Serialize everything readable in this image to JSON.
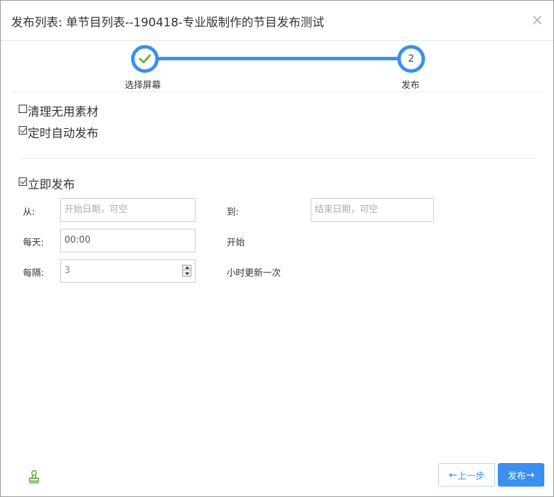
{
  "dialog": {
    "title": "发布列表: 单节目列表--190418-专业版制作的节目发布测试",
    "close_symbol": "×"
  },
  "steps": [
    {
      "label": "选择屏幕",
      "status": "done",
      "icon": "check-icon"
    },
    {
      "label": "发布",
      "number": "2",
      "status": "active"
    }
  ],
  "options": {
    "clean_unused": {
      "label": "清理无用素材",
      "checked": false
    },
    "scheduled_publish": {
      "label": "定时自动发布",
      "checked": true
    },
    "publish_now": {
      "label": "立即发布",
      "checked": true
    }
  },
  "schedule": {
    "from_label": "从:",
    "from_placeholder": "开始日期，可空",
    "to_label": "到:",
    "to_placeholder": "结束日期，可空",
    "daily_label": "每天:",
    "daily_value": "00:00",
    "daily_suffix": "开始",
    "interval_label": "每隔:",
    "interval_value": "3",
    "interval_suffix": "小时更新一次"
  },
  "footer": {
    "stamp_icon": "stamp-icon",
    "prev_label": "上一步",
    "prev_arrow": "←",
    "publish_label": "发布",
    "publish_arrow": "→"
  },
  "colors": {
    "accent": "#3b8ff0",
    "check_green": "#6ab42a"
  }
}
